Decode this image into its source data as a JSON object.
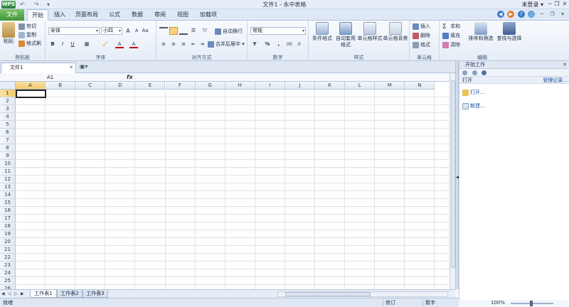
{
  "title_bar": {
    "app_logo": "WPS",
    "quick_access": [
      "↶",
      "↷",
      "▾"
    ],
    "window_title": "文件1 - 永中表格",
    "login": "未登录 ▾",
    "window_controls": [
      "─",
      "❐",
      "✕"
    ]
  },
  "tabs": {
    "file": "文件",
    "items": [
      "开始",
      "插入",
      "页面布局",
      "公式",
      "数据",
      "审阅",
      "视图",
      "加载项"
    ],
    "active": "开始",
    "help_icons": [
      "◀",
      "▶",
      "?",
      "○",
      "─",
      "❐",
      "✕"
    ]
  },
  "ribbon": {
    "clipboard": {
      "label": "剪贴板",
      "paste": "粘贴",
      "cut": "剪切",
      "copy": "复制",
      "format_painter": "格式刷"
    },
    "font": {
      "label": "字体",
      "font_name": "宋体",
      "font_size": "小四",
      "buttons": [
        "A",
        "A",
        "Aa",
        "B",
        "I",
        "U",
        "▦",
        "🖌",
        "A",
        "A"
      ]
    },
    "alignment": {
      "label": "对齐方式",
      "wrap_text": "自动换行",
      "merge_center": "合并后居中"
    },
    "number": {
      "label": "数字",
      "format": "常规",
      "buttons": [
        "Y",
        "%",
        ",",
        ".00",
        ".0"
      ]
    },
    "styles": {
      "label": "样式",
      "conditional": "条件格式",
      "auto_table_1": "自动套用",
      "auto_table_2": "格式",
      "cell_style": "单元格样式",
      "cell_bg": "单元格背景"
    },
    "cells": {
      "label": "单元格",
      "insert": "插入",
      "delete": "删除",
      "format": "格式"
    },
    "editing": {
      "label": "编辑",
      "sum": "求和",
      "fill": "填充",
      "clear": "清除",
      "sort_filter": "排序和筛选",
      "find_select": "查找与选择"
    }
  },
  "document": {
    "tab_name": "文件1",
    "name_box": "A1",
    "fx": "fx"
  },
  "grid": {
    "columns": [
      "A",
      "B",
      "C",
      "D",
      "E",
      "F",
      "G",
      "H",
      "I",
      "J",
      "K",
      "L",
      "M",
      "N"
    ],
    "rows": [
      "1",
      "2",
      "3",
      "4",
      "5",
      "6",
      "7",
      "8",
      "9",
      "10",
      "11",
      "12",
      "13",
      "14",
      "15",
      "16",
      "17",
      "18",
      "19",
      "20",
      "21",
      "22",
      "23",
      "24",
      "25",
      "26"
    ],
    "selected_cell": "A1"
  },
  "task_pane": {
    "title": "开始工作",
    "close": "✕",
    "section": "打开",
    "manage": "管理记录...",
    "open_link": "打开...",
    "new_link": "新建..."
  },
  "sheets": {
    "nav": [
      "◀",
      "◁",
      "▷",
      "▶"
    ],
    "tabs": [
      "工作表1",
      "工作表2",
      "工作表3"
    ],
    "active": "工作表1"
  },
  "status": {
    "ready": "就绪",
    "overwrite": "修订",
    "numlock": "数字",
    "zoom": "100%"
  },
  "colors": {
    "file_green": "#4aa23f",
    "ribbon_bg": "#eef3fa",
    "link_blue": "#1a4fa0"
  }
}
